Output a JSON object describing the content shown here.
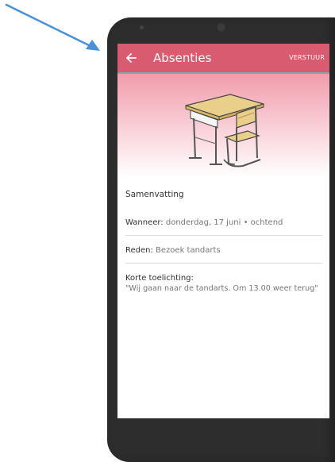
{
  "appbar": {
    "back_icon": "arrow-left-icon",
    "title": "Absenties",
    "action_label": "VERSTUUR"
  },
  "hero": {
    "illustration_icon": "school-desk-and-chair-icon"
  },
  "summary": {
    "title": "Samenvatting",
    "when_label": "Wanneer:",
    "when_value": "donderdag, 17 juni • ochtend",
    "reason_label": "Reden:",
    "reason_value": "Bezoek tandarts",
    "note_label": "Korte toelichting:",
    "note_value": "\"Wij gaan naar de tandarts. Om 13.00 weer terug\""
  },
  "colors": {
    "appbar": "#d85b6f",
    "appbar_border": "#7fa6ab",
    "pointer_arrow": "#4a90d9",
    "phone_body": "#2d2d2d"
  }
}
